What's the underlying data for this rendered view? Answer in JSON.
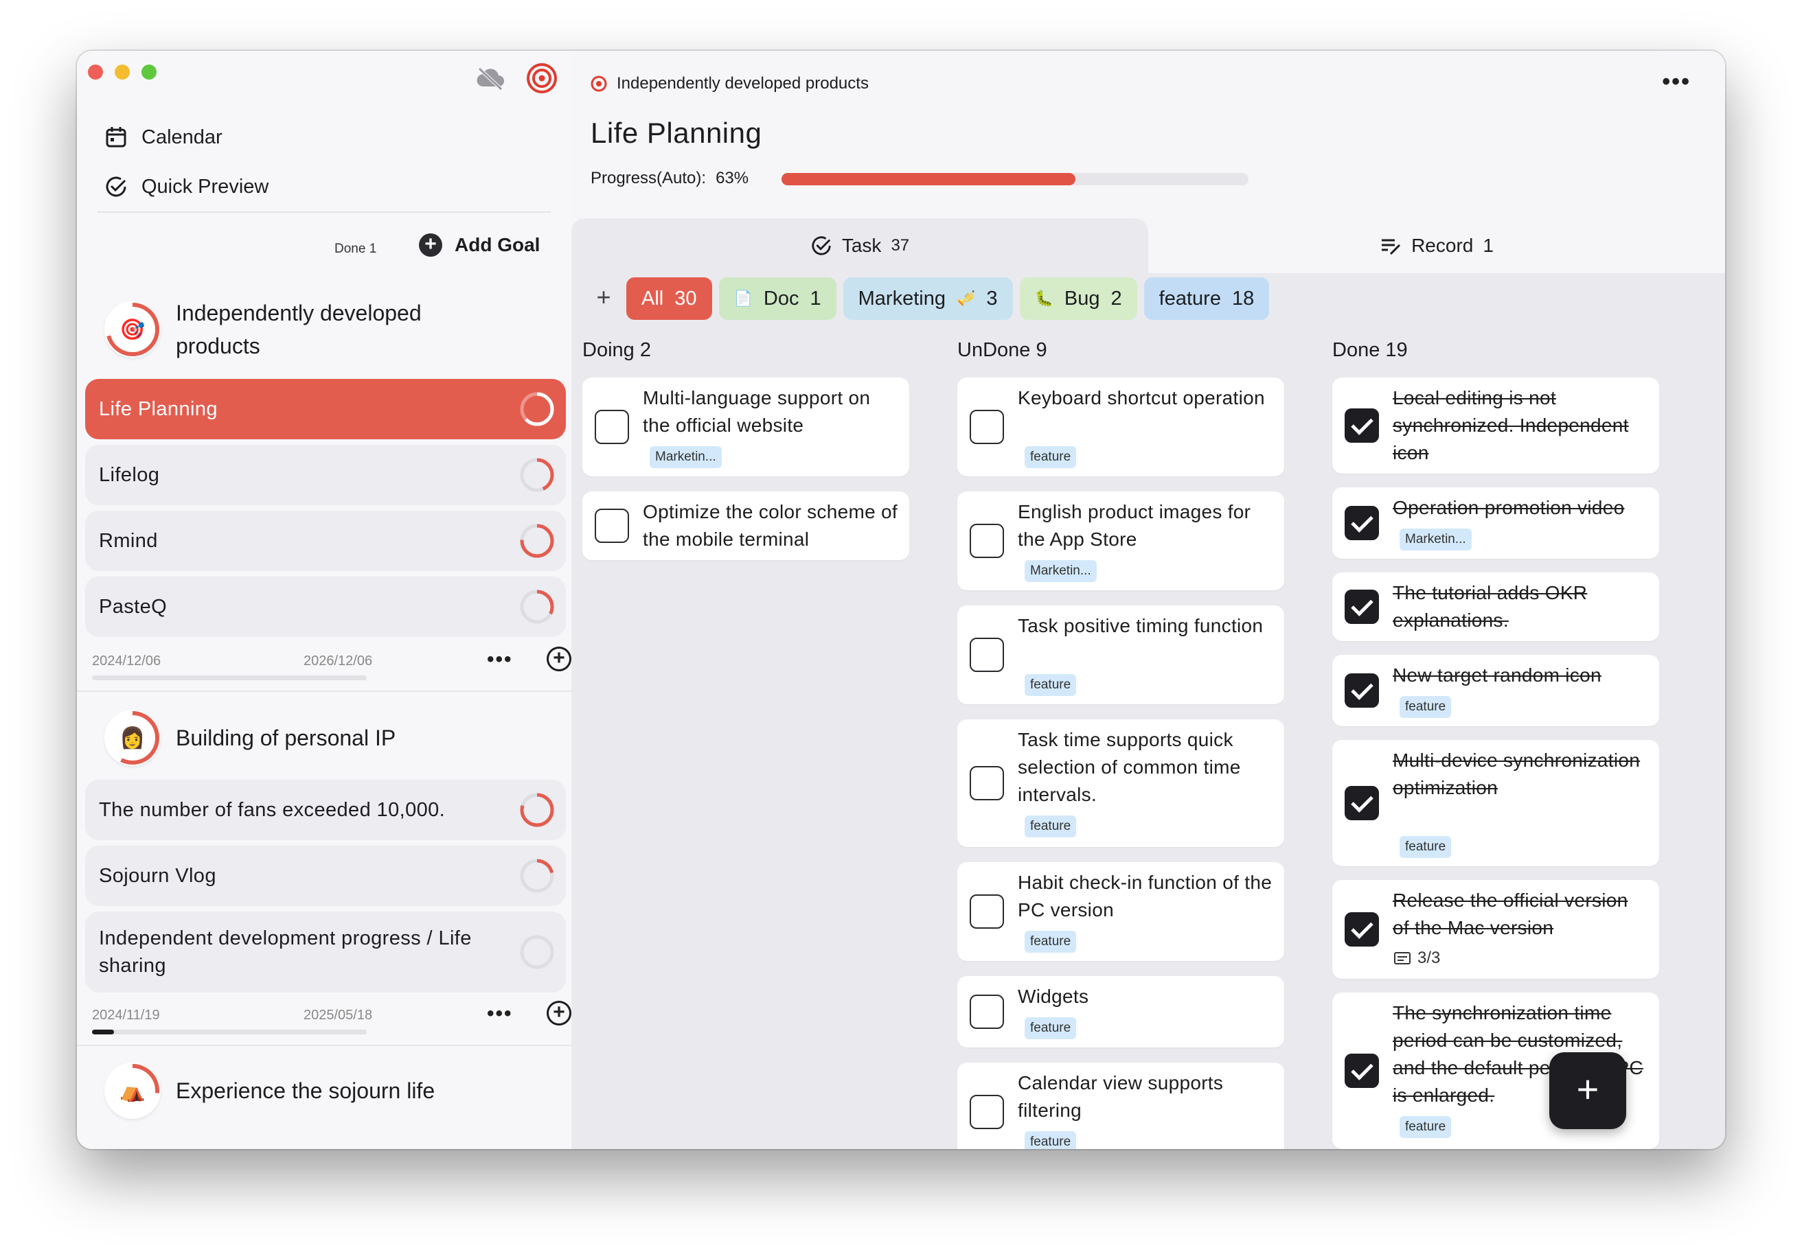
{
  "sidebar": {
    "nav": [
      {
        "label": "Calendar",
        "icon": "calendar-icon"
      },
      {
        "label": "Quick Preview",
        "icon": "check-circle-icon"
      }
    ],
    "done_label": "Done 1",
    "add_goal_label": "Add Goal",
    "groups": [
      {
        "title": "Independently developed products",
        "emoji": "🎯",
        "start": "2024/12/06",
        "end": "2026/12/06",
        "time_progress": 0.0,
        "items": [
          "Life Planning",
          "Lifelog",
          "Rmind",
          "PasteQ"
        ]
      },
      {
        "title": "Building of personal IP",
        "emoji": "👩",
        "start": "2024/11/19",
        "end": "2025/05/18",
        "time_progress": 0.08,
        "items": [
          "The number of fans exceeded 10,000.",
          "Sojourn Vlog",
          "Independent development progress / Life sharing"
        ]
      },
      {
        "title": "Experience the sojourn life",
        "emoji": "⛺"
      }
    ]
  },
  "main": {
    "breadcrumb": "Independently developed products",
    "title": "Life Planning",
    "progress_label": "Progress(Auto):",
    "progress_value": "63%",
    "progress_fraction": 0.63,
    "tabs": {
      "task_label": "Task",
      "task_count": "37",
      "record_label": "Record",
      "record_count": "1"
    },
    "filters": [
      {
        "label": "All",
        "count": "30"
      },
      {
        "label": "Doc",
        "count": "1",
        "emoji": "📄"
      },
      {
        "label": "Marketing",
        "count": "3",
        "emoji": "🎺"
      },
      {
        "label": "Bug",
        "count": "2",
        "emoji": "🐛"
      },
      {
        "label": "feature",
        "count": "18"
      }
    ],
    "columns": {
      "doing": {
        "label": "Doing 2",
        "cards": [
          {
            "title": "Multi-language support on the official website",
            "tag": "Marketin..."
          },
          {
            "title": "Optimize the color scheme of the mobile terminal"
          }
        ]
      },
      "undone": {
        "label": "UnDone 9",
        "cards": [
          {
            "title": "Keyboard shortcut operation",
            "tag": "feature"
          },
          {
            "title": "English product images for the App Store",
            "tag": "Marketin..."
          },
          {
            "title": "Task positive timing function",
            "tag": "feature"
          },
          {
            "title": "Task time supports quick selection of common time intervals.",
            "tag": "feature"
          },
          {
            "title": "Habit check-in function of the PC version",
            "tag": "feature"
          },
          {
            "title": "Widgets",
            "tag": "feature"
          },
          {
            "title": "Calendar view supports filtering",
            "tag": "feature"
          }
        ]
      },
      "done": {
        "label": "Done 19",
        "cards": [
          {
            "title": "Local editing is not synchronized. Independent icon"
          },
          {
            "title": "Operation promotion video",
            "tag": "Marketin..."
          },
          {
            "title": "The tutorial adds OKR explanations."
          },
          {
            "title": "New target random icon",
            "tag": "feature"
          },
          {
            "title": "Multi-device synchronization optimization",
            "tag": "feature"
          },
          {
            "title": "Release the official version of the Mac version",
            "subtasks": "3/3"
          },
          {
            "title": "The synchronization time period can be customized, and the default period on PC is enlarged.",
            "tag": "feature"
          }
        ]
      }
    },
    "fab_label": "+"
  },
  "colors": {
    "accent": "#e35d4f",
    "progress": "#e15445",
    "dark": "#1d1d22",
    "tag_blue": "#d3e9fb"
  }
}
